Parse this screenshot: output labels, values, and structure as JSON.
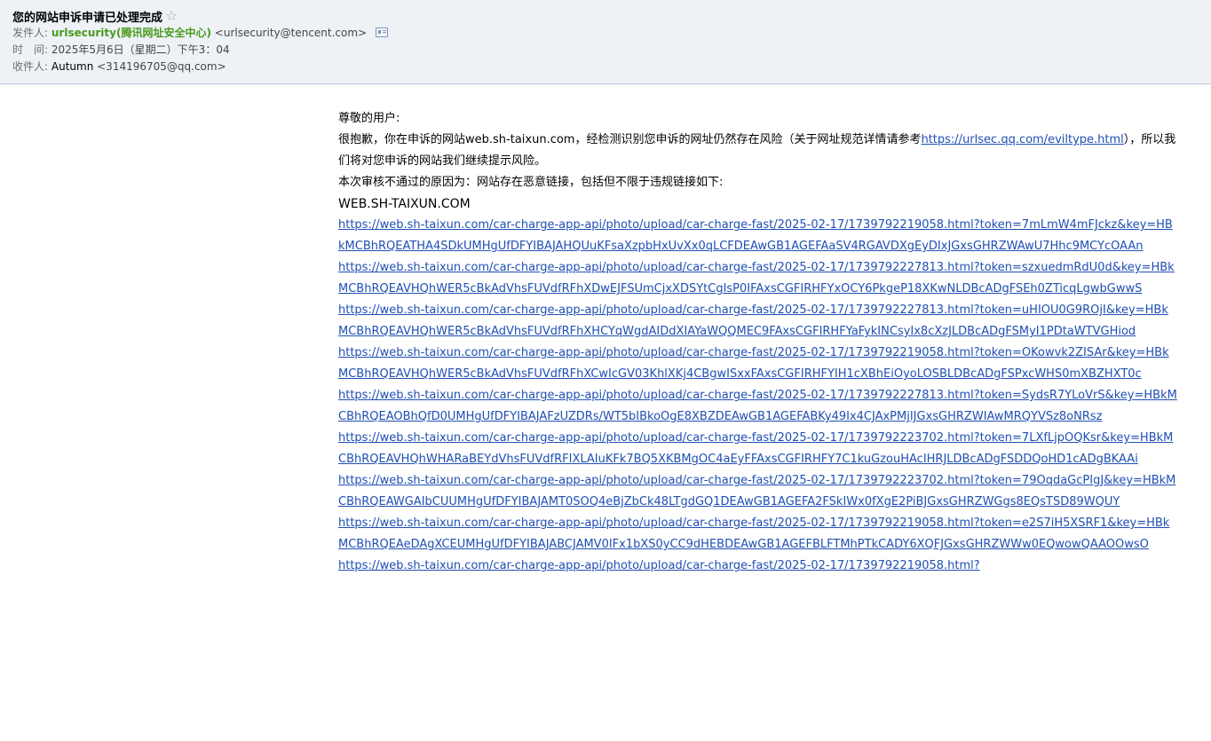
{
  "email": {
    "subject": "您的网站申诉申请已处理完成",
    "star_icon": "☆",
    "from_label": "发件人:",
    "from_name": "urlsecurity(腾讯网址安全中心)",
    "from_email": "<urlsecurity@tencent.com>",
    "time_label": "时　间:",
    "time_value": "2025年5月6日（星期二）下午3：04",
    "to_label": "收件人:",
    "to_name": "Autumn",
    "to_email": "<314196705@qq.com>"
  },
  "body": {
    "greeting": "尊敬的用户:",
    "line1_prefix": "很抱歉，你在申诉的网站web.sh-taixun.com，经检测识别您申诉的网址仍然存在风险（关于网址规范详情请参考",
    "reference_link": "https://urlsec.qq.com/eviltype.html",
    "line1_suffix": "），所以我们将对您申诉的网站我们继续提示风险。",
    "reason": "本次审核不通过的原因为：网站存在恶意链接，包括但不限于违规链接如下:",
    "domain": "WEB.SH-TAIXUN.COM",
    "urls": [
      "https://web.sh-taixun.com/car-charge-app-api/photo/upload/car-charge-fast/2025-02-17/1739792219058.html?token=7mLmW4mFJckz&key=HBkMCBhRQEATHA4SDkUMHgUfDFYIBAJAHQUuKFsaXzpbHxUvXx0qLCFDEAwGB1AGEFAaSV4RGAVDXgEyDIxJGxsGHRZWAwU7Hhc9MCYcOAAn",
      "https://web.sh-taixun.com/car-charge-app-api/photo/upload/car-charge-fast/2025-02-17/1739792227813.html?token=szxuedmRdU0d&key=HBkMCBhRQEAVHQhWER5cBkAdVhsFUVdfRFhXDwEJFSUmCjxXDSYtCgIsP0IFAxsCGFIRHFYxOCY6PkgeP18XKwNLDBcADgFSEh0ZTicqLgwbGwwS",
      "https://web.sh-taixun.com/car-charge-app-api/photo/upload/car-charge-fast/2025-02-17/1739792227813.html?token=uHIOU0G9ROjI&key=HBkMCBhRQEAVHQhWER5cBkAdVhsFUVdfRFhXHCYqWgdAIDdXIAYaWQQMEC9FAxsCGFIRHFYaFykINCsyIx8cXzJLDBcADgFSMyI1PDtaWTVGHiod",
      "https://web.sh-taixun.com/car-charge-app-api/photo/upload/car-charge-fast/2025-02-17/1739792219058.html?token=OKowvk2ZISAr&key=HBkMCBhRQEAVHQhWER5cBkAdVhsFUVdfRFhXCwIcGV03KhlXKj4CBgwISxxFAxsCGFIRHFYIH1cXBhEiOyoLOSBLDBcADgFSPxcWHS0mXBZHXT0c",
      "https://web.sh-taixun.com/car-charge-app-api/photo/upload/car-charge-fast/2025-02-17/1739792227813.html?token=SydsR7YLoVrS&key=HBkMCBhRQEAOBhQfD0UMHgUfDFYIBAJAFzUZDRs/WT5bIBkoOgE8XBZDEAwGB1AGEFABKy49Ix4CJAxPMjIJGxsGHRZWIAwMRQYVSz8oNRsz",
      "https://web.sh-taixun.com/car-charge-app-api/photo/upload/car-charge-fast/2025-02-17/1739792223702.html?token=7LXfLjpOQKsr&key=HBkMCBhRQEAVHQhWHARaBEYdVhsFUVdfRFIXLAIuKFk7BQ5XKBMgOC4aEyFFAxsCGFIRHFY7C1kuGzouHAcIHRJLDBcADgFSDDQoHD1cADgBKAAi",
      "https://web.sh-taixun.com/car-charge-app-api/photo/upload/car-charge-fast/2025-02-17/1739792223702.html?token=79OqdaGcPIgJ&key=HBkMCBhRQEAWGAIbCUUMHgUfDFYIBAJAMT0SOQ4eBjZbCk48LTgdGQ1DEAwGB1AGEFA2FSkIWx0fXgE2PiBJGxsGHRZWGgs8EQsTSD89WQUY",
      "https://web.sh-taixun.com/car-charge-app-api/photo/upload/car-charge-fast/2025-02-17/1739792219058.html?token=e2S7iH5XSRF1&key=HBkMCBhRQEAeDAgXCEUMHgUfDFYIBAJABCJAMV0IFx1bXS0yCC9dHEBDEAwGB1AGEFBLFTMhPTkCADY6XQFJGxsGHRZWWw0EQwowQAAOOwsO",
      "https://web.sh-taixun.com/car-charge-app-api/photo/upload/car-charge-fast/2025-02-17/1739792219058.html?"
    ]
  }
}
